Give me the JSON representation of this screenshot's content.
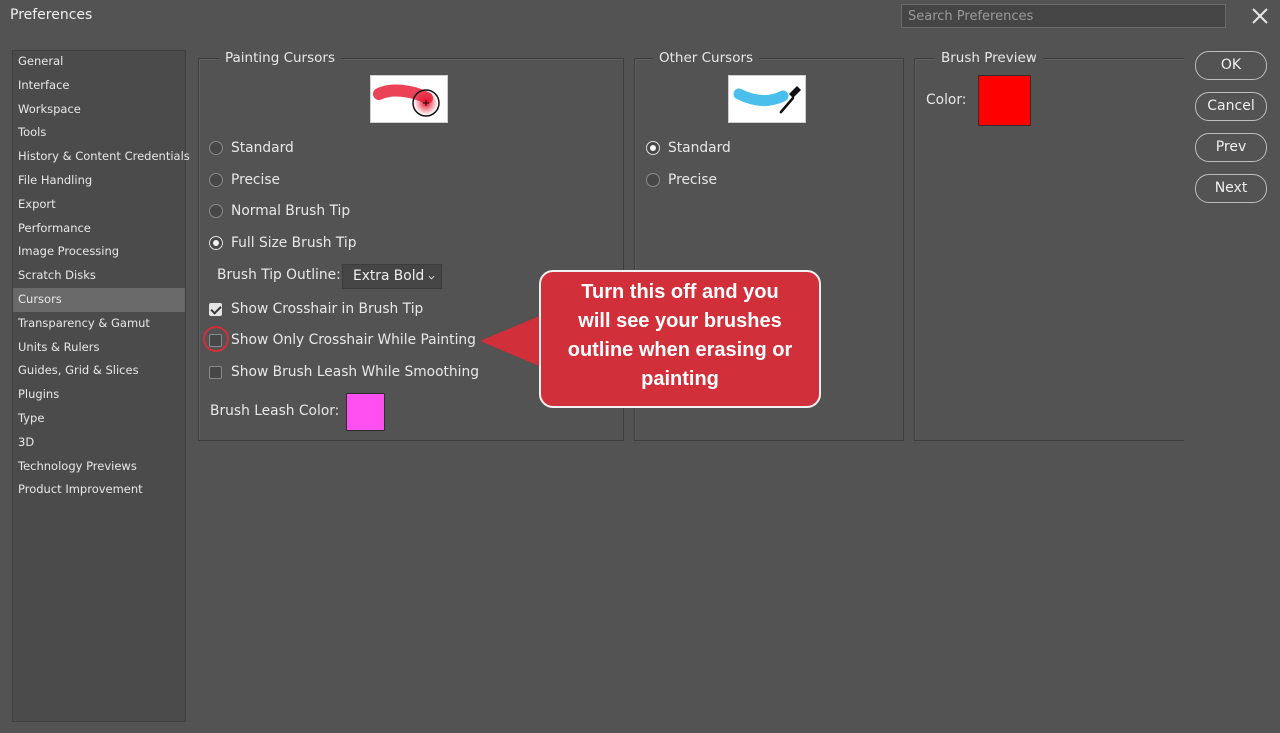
{
  "window": {
    "title": "Preferences"
  },
  "search": {
    "placeholder": "Search Preferences"
  },
  "sidebar": {
    "items": [
      {
        "label": "General"
      },
      {
        "label": "Interface"
      },
      {
        "label": "Workspace"
      },
      {
        "label": "Tools"
      },
      {
        "label": "History & Content Credentials"
      },
      {
        "label": "File Handling"
      },
      {
        "label": "Export"
      },
      {
        "label": "Performance"
      },
      {
        "label": "Image Processing"
      },
      {
        "label": "Scratch Disks"
      },
      {
        "label": "Cursors",
        "active": true
      },
      {
        "label": "Transparency & Gamut"
      },
      {
        "label": "Units & Rulers"
      },
      {
        "label": "Guides, Grid & Slices"
      },
      {
        "label": "Plugins"
      },
      {
        "label": "Type"
      },
      {
        "label": "3D"
      },
      {
        "label": "Technology Previews"
      },
      {
        "label": "Product Improvement"
      }
    ]
  },
  "painting_cursors": {
    "title": "Painting Cursors",
    "options": {
      "standard": "Standard",
      "precise": "Precise",
      "normal_brush_tip": "Normal Brush Tip",
      "full_size_brush_tip": "Full Size Brush Tip"
    },
    "selected": "full_size_brush_tip",
    "brush_tip_outline_label": "Brush Tip Outline:",
    "brush_tip_outline_value": "Extra Bold",
    "show_crosshair_label": "Show Crosshair in Brush Tip",
    "show_crosshair_checked": true,
    "show_only_crosshair_label": "Show Only Crosshair While Painting",
    "show_only_crosshair_checked": false,
    "show_brush_leash_label": "Show Brush Leash While Smoothing",
    "show_brush_leash_checked": false,
    "brush_leash_color_label": "Brush Leash Color:",
    "brush_leash_color": "#ff4ff0"
  },
  "other_cursors": {
    "title": "Other Cursors",
    "options": {
      "standard": "Standard",
      "precise": "Precise"
    },
    "selected": "standard"
  },
  "brush_preview": {
    "title": "Brush Preview",
    "color_label": "Color:",
    "color": "#ff0000"
  },
  "buttons": {
    "ok": "OK",
    "cancel": "Cancel",
    "prev": "Prev",
    "next": "Next"
  },
  "annotation": {
    "line1": "Turn this off and you",
    "line2": "will see your brushes",
    "line3": "outline when erasing or",
    "line4": "painting",
    "color": "#d12f3a"
  }
}
